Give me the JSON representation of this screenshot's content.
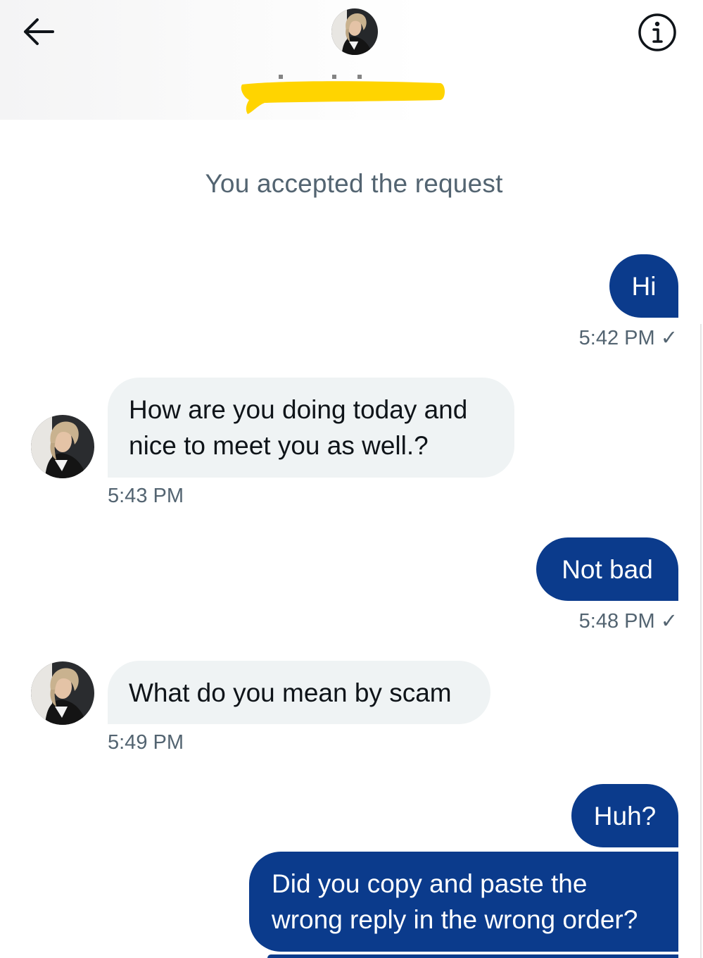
{
  "header": {
    "back_icon": "arrow-left-icon",
    "info_icon": "info-icon",
    "contact_name_redacted": true
  },
  "system_message": "You accepted the request",
  "colors": {
    "sent_bubble": "#0b3b8c",
    "received_bubble": "#eff3f4",
    "meta_text": "#536471",
    "redaction_marker": "#ffd400"
  },
  "messages": [
    {
      "direction": "sent",
      "lines": [
        "Hi"
      ],
      "time": "5:42 PM ✓"
    },
    {
      "direction": "received",
      "lines": [
        "How are you doing today and",
        "nice to meet you as well.?"
      ],
      "time": "5:43 PM"
    },
    {
      "direction": "sent",
      "lines": [
        "Not bad"
      ],
      "time": "5:48 PM ✓"
    },
    {
      "direction": "received",
      "lines": [
        "What do you mean by scam"
      ],
      "time": "5:49 PM"
    },
    {
      "direction": "sent",
      "lines": [
        "Huh?"
      ],
      "time": ""
    },
    {
      "direction": "sent",
      "lines": [
        "Did you copy and paste the",
        "wrong reply in the wrong order?"
      ],
      "time": ""
    }
  ]
}
